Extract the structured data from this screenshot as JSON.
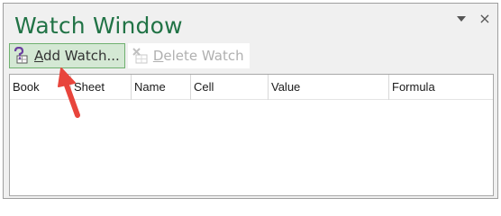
{
  "window": {
    "title": "Watch Window",
    "controls": {
      "dropdown_icon": "chevron-down-icon",
      "close_icon": "close-icon",
      "close_glyph": "×"
    }
  },
  "toolbar": {
    "add_watch": {
      "underline": "A",
      "rest": "dd Watch...",
      "icon": "add-watch-icon"
    },
    "delete_watch": {
      "underline": "D",
      "rest": "elete Watch",
      "icon": "delete-watch-icon"
    }
  },
  "list": {
    "columns": [
      "Book",
      "Sheet",
      "Name",
      "Cell",
      "Value",
      "Formula"
    ]
  },
  "annotation": {
    "icon": "red-arrow-pointer",
    "color": "#e8453c"
  },
  "colors": {
    "accent": "#217346",
    "active_button_bg": "#d4e8d4",
    "arrow": "#e8453c"
  }
}
